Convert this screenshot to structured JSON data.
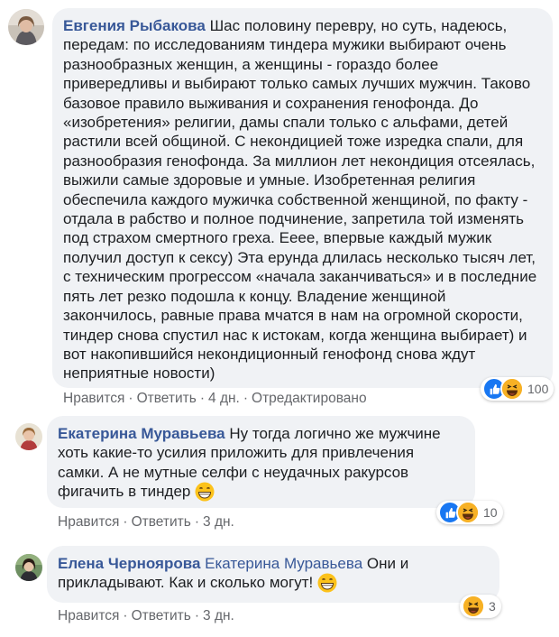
{
  "comments": [
    {
      "author": "Евгения Рыбакова",
      "mention": "",
      "text": "Шас половину переврy, но суть, надеюсь, передам: по исследованиям тиндера мужики выбирают очень разнообразных женщин, а женщины - гораздо более привередливы и выбирают только самых лучших мужчин. Таково базовое правило выживания и сохранения генофонда. До «изобретения» религии, дамы спали только с альфами, детей растили всей общиной. С некондицией тоже изредка спали, для разнообразия генофонда. За миллион лет некондиция отсеялась, выжили самые здоровые и умные. Изобретенная религия обеспечила каждого мужичка собственной женщиной, по факту - отдала в рабство и полное подчинение, запретила той изменять под страхом смертного греха. Еееe, впервые каждый мужик получил доступ к сексу) Эта ерунда длилась несколько тысяч лет, с техническим прогрессом «начала заканчиваться» и в последние пять лет резко подошла к концу. Владение женщиной закончилось, равные права мчатся в нам на огромной скорости, тиндер снова спустил нас к истокам, когда женщина выбирает) и вот накопившийся некондиционный генофонд снова ждут неприятные новости)",
      "actions": {
        "like": "Нравится",
        "reply": "Ответить",
        "time": "4 дн.",
        "edited": "Отредактировано"
      },
      "reaction_count": "100",
      "reaction_icons": [
        "like-icon",
        "haha-icon"
      ]
    },
    {
      "author": "Екатерина Муравьева",
      "mention": "",
      "text": "Ну тогда логично же мужчине хоть какие-то усилия приложить для привлечения самки. А не мутные селфи с неудачных ракурсов фигачить в тиндер",
      "actions": {
        "like": "Нравится",
        "reply": "Ответить",
        "time": "3 дн."
      },
      "reaction_count": "10",
      "reaction_icons": [
        "like-icon",
        "haha-icon"
      ]
    },
    {
      "author": "Елена Черноярова",
      "mention": "Екатерина Муравьева",
      "text": "Они и прикладывают. Как и сколько могут!",
      "actions": {
        "like": "Нравится",
        "reply": "Ответить",
        "time": "3 дн."
      },
      "reaction_count": "3",
      "reaction_icons": [
        "haha-icon"
      ]
    }
  ],
  "colors": {
    "author": "#385898",
    "bubble": "#f0f2f5",
    "meta": "#65676b",
    "like": "#1877f2",
    "haha": "#f7b125"
  }
}
